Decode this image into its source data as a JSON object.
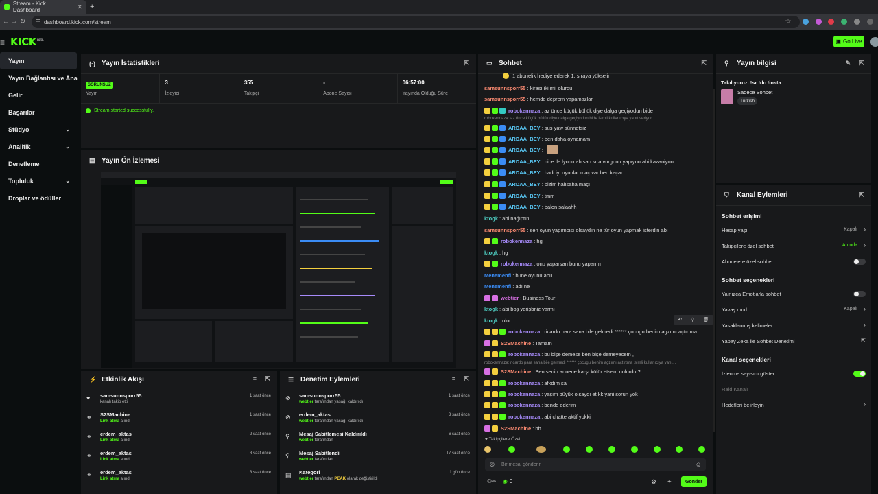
{
  "browser": {
    "tab_title": "Stream - Kick Dashboard",
    "url": "dashboard.kick.com/stream"
  },
  "topbar": {
    "logo": "KICK",
    "logo_tag": "BETA",
    "go_live": "Go Live"
  },
  "sidebar": {
    "items": [
      {
        "label": "Yayın",
        "active": true
      },
      {
        "label": "Yayın Bağlantısı ve Anahtarı"
      },
      {
        "label": "Gelir"
      },
      {
        "label": "Başarılar"
      },
      {
        "label": "Stüdyo",
        "chevron": true
      },
      {
        "label": "Analitik",
        "chevron": true
      },
      {
        "label": "Denetleme"
      },
      {
        "label": "Topluluk",
        "chevron": true
      },
      {
        "label": "Droplar ve ödüller"
      }
    ]
  },
  "stats_panel": {
    "title": "Yayın İstatistikleri",
    "badge": "SORUNSUZ",
    "stats": [
      {
        "value": "",
        "label": "Yayın"
      },
      {
        "value": "3",
        "label": "İzleyici"
      },
      {
        "value": "355",
        "label": "Takipçi"
      },
      {
        "value": "-",
        "label": "Abone Sayısı"
      },
      {
        "value": "06:57:00",
        "label": "Yayında Olduğu Süre"
      }
    ],
    "status_msg": "Stream started successfully."
  },
  "preview_panel": {
    "title": "Yayın Ön İzlemesi"
  },
  "activity_panel": {
    "title": "Etkinlik Akışı",
    "items": [
      {
        "name": "samsunnsporr55",
        "sub": "kanalı takip etti",
        "time": "1 saat önce",
        "icon": "heart-icon",
        "glyph": "♥"
      },
      {
        "name": "S2SMachine",
        "sub_highlight": "Link atma",
        "sub": " alındı",
        "time": "1 saat önce",
        "icon": "share-icon",
        "glyph": "⚭"
      },
      {
        "name": "erdem_aktas",
        "sub_highlight": "Link atma",
        "sub": " alındı",
        "time": "2 saat önce",
        "icon": "share-icon",
        "glyph": "⚭"
      },
      {
        "name": "erdem_aktas",
        "sub_highlight": "Link atma",
        "sub": " alındı",
        "time": "3 saat önce",
        "icon": "share-icon",
        "glyph": "⚭"
      },
      {
        "name": "erdem_aktas",
        "sub_highlight": "Link atma",
        "sub": " alındı",
        "time": "3 saat önce",
        "icon": "share-icon",
        "glyph": "⚭"
      }
    ]
  },
  "mod_panel": {
    "title": "Denetim Eylemleri",
    "items": [
      {
        "name": "samsunnsporr55",
        "actor": "webtier",
        "sub": " tarafından yasağı kaldırıldı",
        "time": "1 saat önce",
        "icon": "unban-icon",
        "glyph": "⊘"
      },
      {
        "name": "erdem_aktas",
        "actor": "webtier",
        "sub": " tarafından yasağı kaldırıldı",
        "time": "3 saat önce",
        "icon": "unban-icon",
        "glyph": "⊘"
      },
      {
        "name": "Mesaj Sabitlemesi Kaldırıldı",
        "actor": "webtier",
        "sub": " tarafından",
        "time": "6 saat önce",
        "icon": "unpin-icon",
        "glyph": "⚲"
      },
      {
        "name": "Mesaj Sabitlendi",
        "actor": "webtier",
        "sub": " tarafından",
        "time": "17 saat önce",
        "icon": "pin-icon",
        "glyph": "⚲"
      },
      {
        "name": "Kategori",
        "actor": "webtier",
        "sub": " tarafından ",
        "extra": "PEAK",
        "sub2": " olarak değiştirildi",
        "time": "1 gün önce",
        "icon": "category-icon",
        "glyph": "▤"
      }
    ]
  },
  "chat": {
    "title": "Sohbet",
    "banner": "1 abonelik hediye ederek 1. sıraya yükselin",
    "messages": [
      {
        "user": "samsunnsporr55",
        "color": "#ff8c73",
        "badges": [],
        "text": ": kirası iki mil olurdu"
      },
      {
        "user": "samsunnsporr55",
        "color": "#ff8c73",
        "badges": [],
        "text": ": hemde deprem yapamazlar"
      },
      {
        "user": "robokennaza",
        "color": "#a78bfa",
        "badges": [
          "y",
          "g",
          "t"
        ],
        "text": ": az önce küçük büllük diye dalga geçiyodun bide"
      },
      {
        "sys": "robokennaza: az önce küçük büllük diye dalga geçiyodun bide isimli kullanıcıya yanıt veriyor"
      },
      {
        "user": "ARDAA_BEY",
        "color": "#59c8f5",
        "badges": [
          "y",
          "g",
          "b"
        ],
        "text": ": sus yaw sünnetsiz"
      },
      {
        "user": "ARDAA_BEY",
        "color": "#59c8f5",
        "badges": [
          "y",
          "g",
          "b"
        ],
        "text": ": ben daha oynamam"
      },
      {
        "user": "ARDAA_BEY",
        "color": "#59c8f5",
        "badges": [
          "y",
          "g",
          "b"
        ],
        "text": ":",
        "emote": true
      },
      {
        "user": "ARDAA_BEY",
        "color": "#59c8f5",
        "badges": [
          "y",
          "g",
          "b"
        ],
        "text": ": nice ile lyonu alırsan sıra vurgunu yapıyon abi kazaniyon"
      },
      {
        "user": "ARDAA_BEY",
        "color": "#59c8f5",
        "badges": [
          "y",
          "g",
          "b"
        ],
        "text": ": hadi iyi oyunlar maç var ben kaçar"
      },
      {
        "user": "ARDAA_BEY",
        "color": "#59c8f5",
        "badges": [
          "y",
          "g",
          "b"
        ],
        "text": ": bizim halısaha maçı"
      },
      {
        "user": "ARDAA_BEY",
        "color": "#59c8f5",
        "badges": [
          "y",
          "g",
          "b"
        ],
        "text": ": tmm"
      },
      {
        "user": "ARDAA_BEY",
        "color": "#59c8f5",
        "badges": [
          "y",
          "g",
          "b"
        ],
        "text": ": balon salaahh"
      },
      {
        "user": "ktogk",
        "color": "#4fd1c5",
        "badges": [],
        "text": ": abi nağıptın"
      },
      {
        "user": "samsunnsporr55",
        "color": "#ff8c73",
        "badges": [],
        "text": ": sen oyun yapımcısı olsaydın ne tür oyun yapmak isterdin abi"
      },
      {
        "user": "robokennaza",
        "color": "#a78bfa",
        "badges": [
          "y",
          "g"
        ],
        "text": ": hg"
      },
      {
        "user": "ktogk",
        "color": "#4fd1c5",
        "badges": [],
        "text": ": hg"
      },
      {
        "user": "robokennaza",
        "color": "#a78bfa",
        "badges": [
          "y",
          "g"
        ],
        "text": ": onu yaparsan bunu yaparım"
      },
      {
        "user": "Menemenfi",
        "color": "#3b8cf5",
        "badges": [],
        "text": ": bune oyunu abu"
      },
      {
        "user": "Menemenfi",
        "color": "#3b8cf5",
        "badges": [],
        "text": ": adı ne"
      },
      {
        "user": "webtier",
        "color": "#d770e3",
        "badges": [
          "p",
          "p"
        ],
        "text": ": Business Tour"
      },
      {
        "user": "ktogk",
        "color": "#4fd1c5",
        "badges": [],
        "text": ": abi boş yerişbniz varmı"
      },
      {
        "user": "ktogk",
        "color": "#4fd1c5",
        "badges": [],
        "text": ": olur"
      },
      {
        "user": "robokennaza",
        "color": "#a78bfa",
        "badges": [
          "y",
          "y",
          "g"
        ],
        "text": ": ricardo para sana bile gelmedi ****** çocugu benim agzımı açtırtma"
      },
      {
        "user": "S2SMachine",
        "color": "#ff8c73",
        "badges": [
          "p",
          "y"
        ],
        "text": ": Tamam"
      },
      {
        "user": "robokennaza",
        "color": "#a78bfa",
        "badges": [
          "y",
          "y",
          "g"
        ],
        "text": ": bu bişe demese ben bişe demeyecem ,"
      },
      {
        "sys": "robokennaza: ricardo para sana bile gelmedi ****** çocugu benim agzımı açtırtma isimli kullanıcıya yanı..."
      },
      {
        "user": "S2SMachine",
        "color": "#ff8c73",
        "badges": [
          "p",
          "y"
        ],
        "text": ": Ben senin annene karşı küfür etsem nolurdu ?"
      },
      {
        "user": "robokennaza",
        "color": "#a78bfa",
        "badges": [
          "y",
          "y",
          "g"
        ],
        "text": ": afkdım sa"
      },
      {
        "user": "robokennaza",
        "color": "#a78bfa",
        "badges": [
          "y",
          "y",
          "g"
        ],
        "text": ": yaşım büyük olsaydı et kk yani sorun yok"
      },
      {
        "user": "robokennaza",
        "color": "#a78bfa",
        "badges": [
          "y",
          "y",
          "g"
        ],
        "text": ": bende ederim"
      },
      {
        "user": "robokennaza",
        "color": "#a78bfa",
        "badges": [
          "y",
          "y",
          "g"
        ],
        "text": ": abi chatte aktif yokki"
      },
      {
        "user": "S2SMachine",
        "color": "#ff8c73",
        "badges": [
          "p",
          "y"
        ],
        "text": ": bb"
      }
    ],
    "followers_only": "Takipçilere Özel",
    "input_placeholder": "Bir mesaj gönderin",
    "points": "0",
    "send": "Gönder"
  },
  "stream_info": {
    "title": "Yayın bilgisi",
    "stream_title": "Takılıyoruz. !sr !dc !insta",
    "category": "Sadece Sohbet",
    "tag": "Turkish"
  },
  "channel_actions": {
    "title": "Kanal Eylemleri",
    "sections": [
      {
        "heading": "Sohbet erişimi",
        "rows": [
          {
            "label": "Hesap yaşı",
            "value": "Kapalı",
            "type": "chev"
          },
          {
            "label": "Takipçilere özel sohbet",
            "value": "Anında",
            "type": "chev",
            "green": true
          },
          {
            "label": "Abonelere özel sohbet",
            "type": "toggle",
            "on": false
          }
        ]
      },
      {
        "heading": "Sohbet seçenekleri",
        "rows": [
          {
            "label": "Yalnızca Emotlarla sohbet",
            "type": "toggle",
            "on": false
          },
          {
            "label": "Yavaş mod",
            "value": "Kapalı",
            "type": "chev"
          },
          {
            "label": "Yasaklanmış kelimeler",
            "type": "chev"
          },
          {
            "label": "Yapay Zeka ile Sohbet Denetimi",
            "type": "ext"
          }
        ]
      },
      {
        "heading": "Kanal seçenekleri",
        "rows": [
          {
            "label": "İzlenme sayısını göster",
            "type": "toggle",
            "on": true
          },
          {
            "label": "Raid Kanalı",
            "type": "none",
            "dim": true
          },
          {
            "label": "Hedefleri belirleyin",
            "type": "chev"
          }
        ]
      }
    ]
  }
}
